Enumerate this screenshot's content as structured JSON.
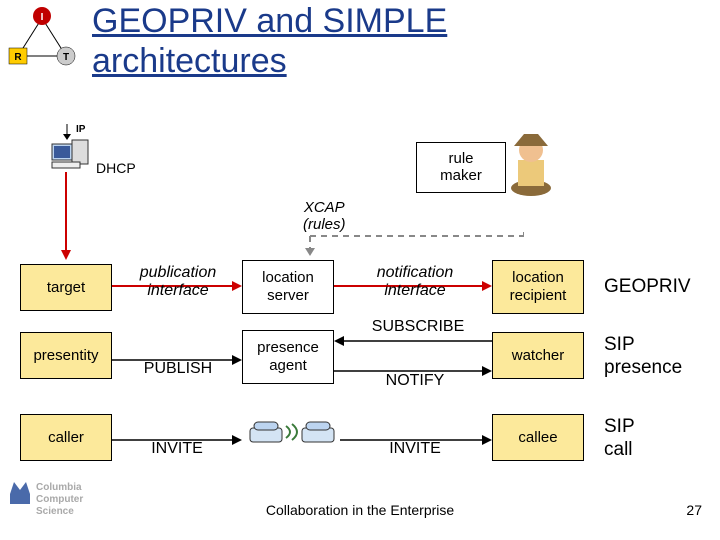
{
  "title_l1": "GEOPRIV and SIMPLE",
  "title_l2": "architectures",
  "irt": {
    "i": "I",
    "r": "R",
    "t": "T"
  },
  "ip": "IP",
  "dhcp": "DHCP",
  "rule_maker_l1": "rule",
  "rule_maker_l2": "maker",
  "xcap_l1": "XCAP",
  "xcap_l2": "(rules)",
  "row1": {
    "left": "target",
    "pub_l1": "publication",
    "pub_l2": "interface",
    "mid": "location\nserver",
    "notif_l1": "notification",
    "notif_l2": "interface",
    "right": "location\nrecipient",
    "side": "GEOPRIV"
  },
  "row2": {
    "left": "presentity",
    "publish": "PUBLISH",
    "mid": "presence\nagent",
    "sub": "SUBSCRIBE",
    "notify": "NOTIFY",
    "right": "watcher",
    "side_l1": "SIP",
    "side_l2": "presence"
  },
  "row3": {
    "left": "caller",
    "invite": "INVITE",
    "invite2": "INVITE",
    "right": "callee",
    "side_l1": "SIP",
    "side_l2": "call"
  },
  "footer_logo_l1": "Columbia",
  "footer_logo_l2": "Computer",
  "footer_logo_l3": "Science",
  "footer_center": "Collaboration in the Enterprise",
  "page": "27"
}
